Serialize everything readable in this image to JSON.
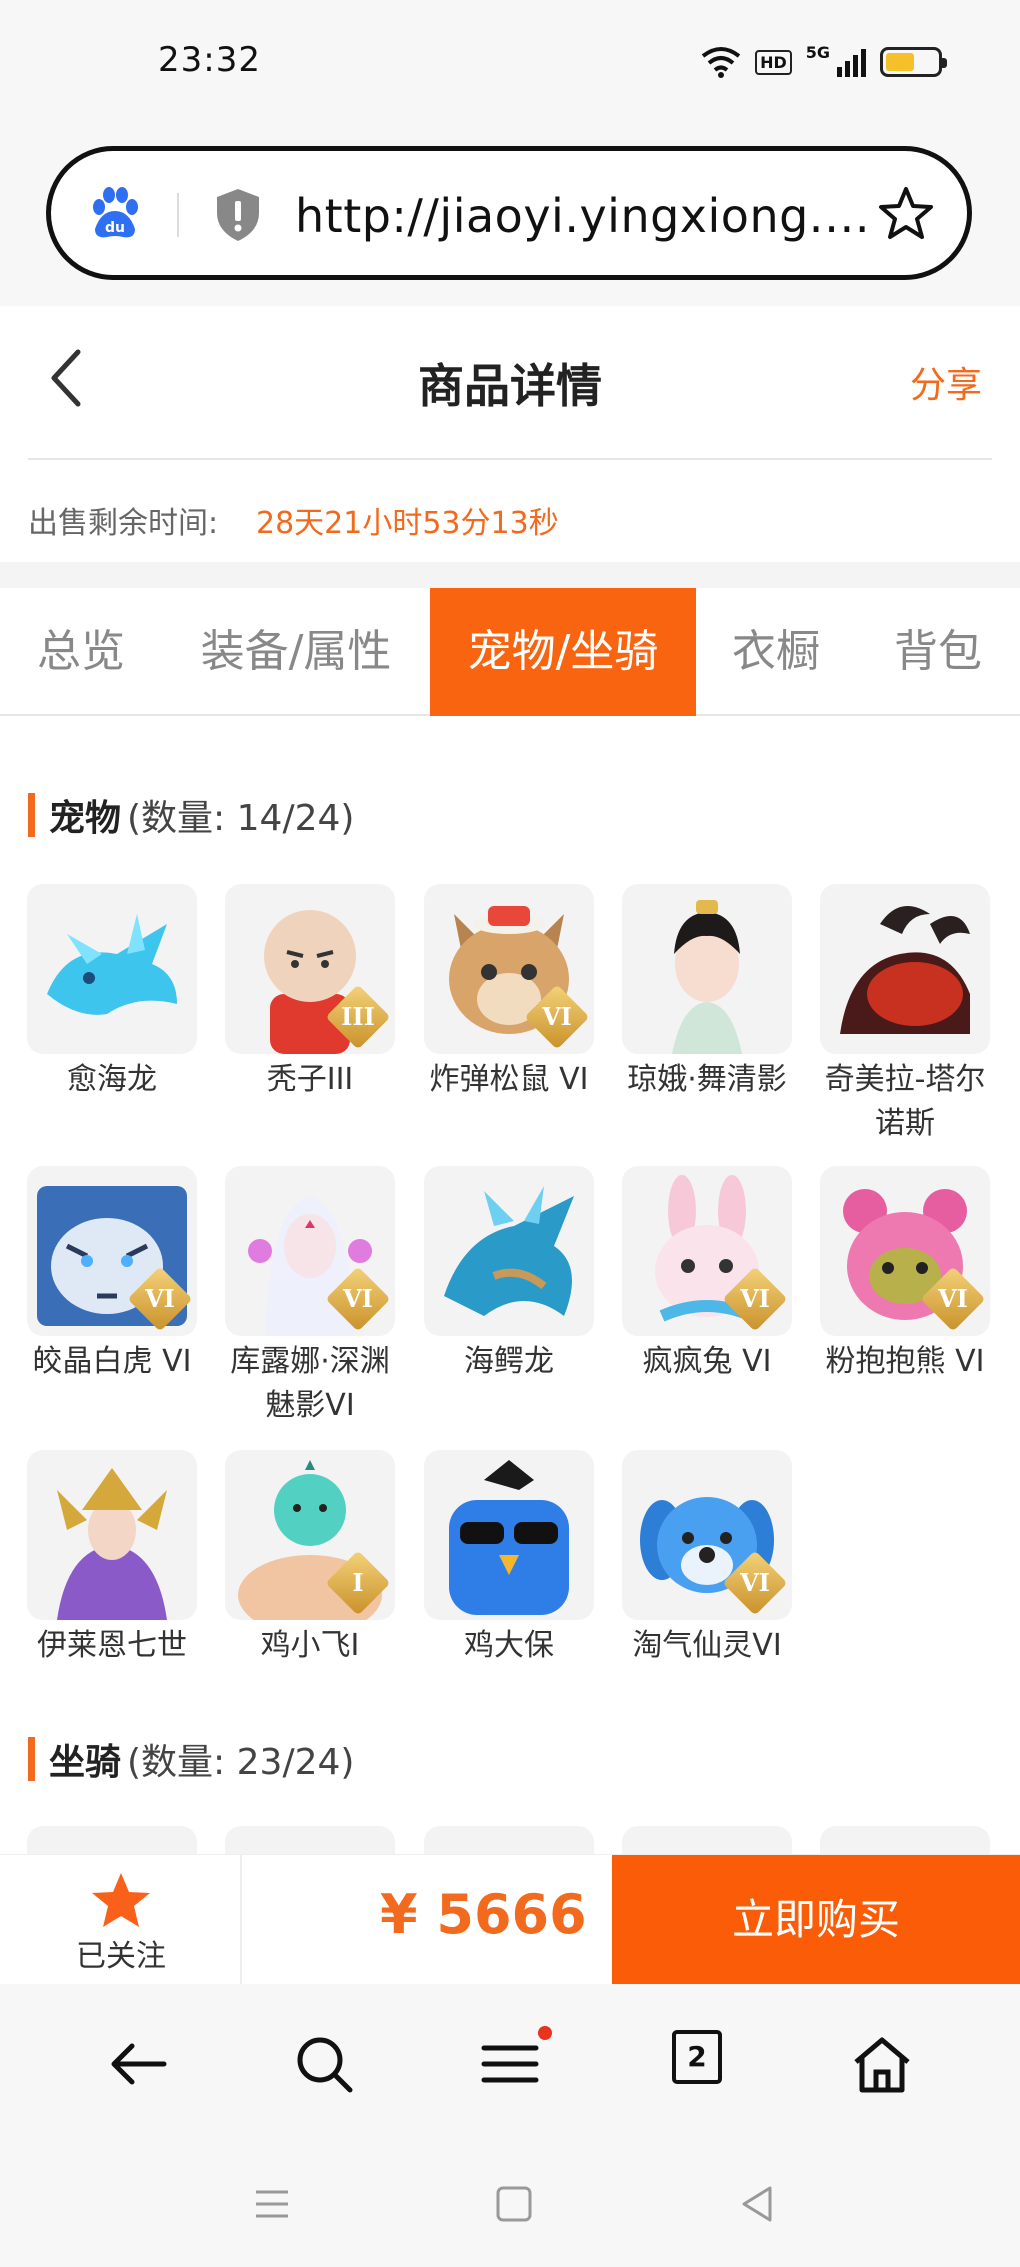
{
  "status_bar": {
    "time": "23:32",
    "hd": "HD",
    "network": "5G",
    "battery_level": 0.55
  },
  "url_bar": {
    "url": "http://jiaoyi.yingxiong.co..."
  },
  "header": {
    "title": "商品详情",
    "share_label": "分享"
  },
  "sale": {
    "remaining_label": "出售剩余时间:",
    "remaining_value": "28天21小时53分13秒"
  },
  "tabs": [
    {
      "label": "总览"
    },
    {
      "label": "装备/属性"
    },
    {
      "label": "宠物/坐骑",
      "active": true
    },
    {
      "label": "衣橱"
    },
    {
      "label": "背包"
    }
  ],
  "pets_section": {
    "title": "宠物",
    "count": "(数量: 14/24)",
    "items": [
      {
        "name": "愈海龙"
      },
      {
        "name": "秃子III",
        "tier": "III"
      },
      {
        "name": "炸弹松鼠 VI",
        "tier": "VI"
      },
      {
        "name": "琼娥·舞清影"
      },
      {
        "name": "奇美拉-塔尔诺斯"
      },
      {
        "name": "皎晶白虎 VI",
        "tier": "VI"
      },
      {
        "name": "库露娜·深渊魅影VI",
        "tier": "VI"
      },
      {
        "name": "海鳄龙"
      },
      {
        "name": "疯疯兔 VI",
        "tier": "VI"
      },
      {
        "name": "粉抱抱熊 VI",
        "tier": "VI"
      },
      {
        "name": "伊莱恩七世"
      },
      {
        "name": "鸡小飞I",
        "tier": "I"
      },
      {
        "name": "鸡大保"
      },
      {
        "name": "淘气仙灵VI",
        "tier": "VI"
      }
    ]
  },
  "mounts_section": {
    "title": "坐骑",
    "count": "(数量: 23/24)"
  },
  "buy_bar": {
    "follow_label": "已关注",
    "price": "¥ 5666",
    "buy_label": "立即购买"
  },
  "browser_nav": {
    "tab_count": "2"
  },
  "colors": {
    "accent": "#f26a1d",
    "tab_active": "#f96411",
    "buy_button": "#fb5c07"
  }
}
